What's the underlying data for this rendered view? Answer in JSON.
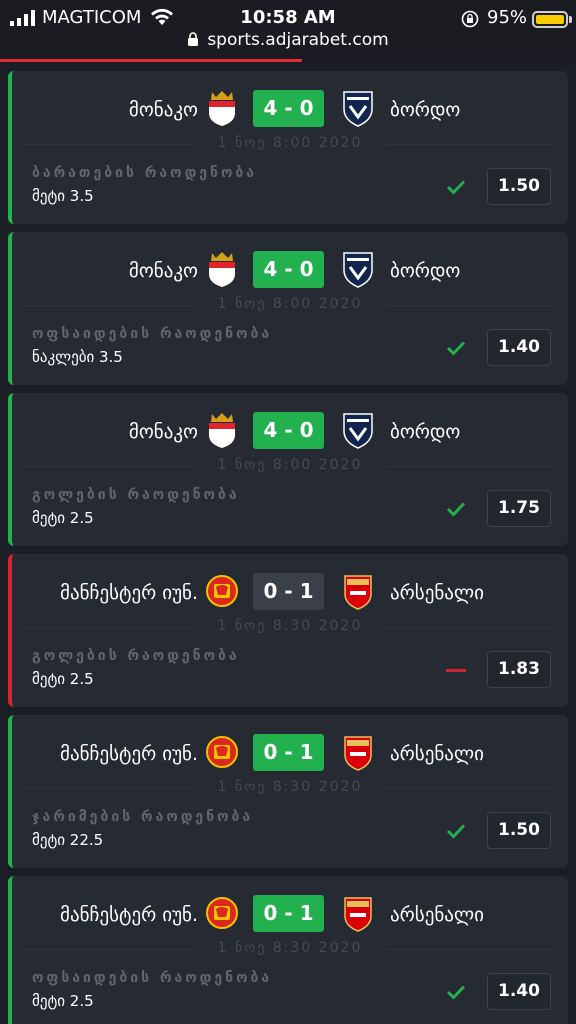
{
  "status_bar": {
    "carrier": "MAGTICOM",
    "time": "10:58 AM",
    "battery_percent": "95%",
    "battery_color": "#f7cc00",
    "url": "sports.adjarabet.com"
  },
  "colors": {
    "win": "#23b04e",
    "loss": "#d3252f",
    "card_bg": "#262a32",
    "page_bg": "#1b1e24"
  },
  "bets": [
    {
      "home_team": "მონაკო",
      "home_logo": "monaco-crest-icon",
      "score": "4 - 0",
      "away_team": "ბორდო",
      "away_logo": "bordeaux-crest-icon",
      "date": "1 ნოე 8:00 2020",
      "market": "ბარათების რაოდენობა",
      "selection": "მეტი 3.5",
      "result": "won",
      "result_icon": "check-icon",
      "odds": "1.50"
    },
    {
      "home_team": "მონაკო",
      "home_logo": "monaco-crest-icon",
      "score": "4 - 0",
      "away_team": "ბორდო",
      "away_logo": "bordeaux-crest-icon",
      "date": "1 ნოე 8:00 2020",
      "market": "ოფსაიდების რაოდენობა",
      "selection": "ნაკლები 3.5",
      "result": "won",
      "result_icon": "check-icon",
      "odds": "1.40"
    },
    {
      "home_team": "მონაკო",
      "home_logo": "monaco-crest-icon",
      "score": "4 - 0",
      "away_team": "ბორდო",
      "away_logo": "bordeaux-crest-icon",
      "date": "1 ნოე 8:00 2020",
      "market": "გოლების რაოდენობა",
      "selection": "მეტი 2.5",
      "result": "won",
      "result_icon": "check-icon",
      "odds": "1.75"
    },
    {
      "home_team": "მანჩესტერ იუნ.",
      "home_logo": "man-utd-crest-icon",
      "score": "0 - 1",
      "away_team": "არსენალი",
      "away_logo": "arsenal-crest-icon",
      "date": "1 ნოე 8:30 2020",
      "market": "გოლების რაოდენობა",
      "selection": "მეტი 2.5",
      "result": "lost",
      "result_icon": "dash-icon",
      "odds": "1.83"
    },
    {
      "home_team": "მანჩესტერ იუნ.",
      "home_logo": "man-utd-crest-icon",
      "score": "0 - 1",
      "away_team": "არსენალი",
      "away_logo": "arsenal-crest-icon",
      "date": "1 ნოე 8:30 2020",
      "market": "ჯარიმების რაოდენობა",
      "selection": "მეტი 22.5",
      "result": "won",
      "result_icon": "check-icon",
      "odds": "1.50"
    },
    {
      "home_team": "მანჩესტერ იუნ.",
      "home_logo": "man-utd-crest-icon",
      "score": "0 - 1",
      "away_team": "არსენალი",
      "away_logo": "arsenal-crest-icon",
      "date": "1 ნოე 8:30 2020",
      "market": "ოფსაიდების რაოდენობა",
      "selection": "მეტი 2.5",
      "result": "won",
      "result_icon": "check-icon",
      "odds": "1.40"
    }
  ]
}
